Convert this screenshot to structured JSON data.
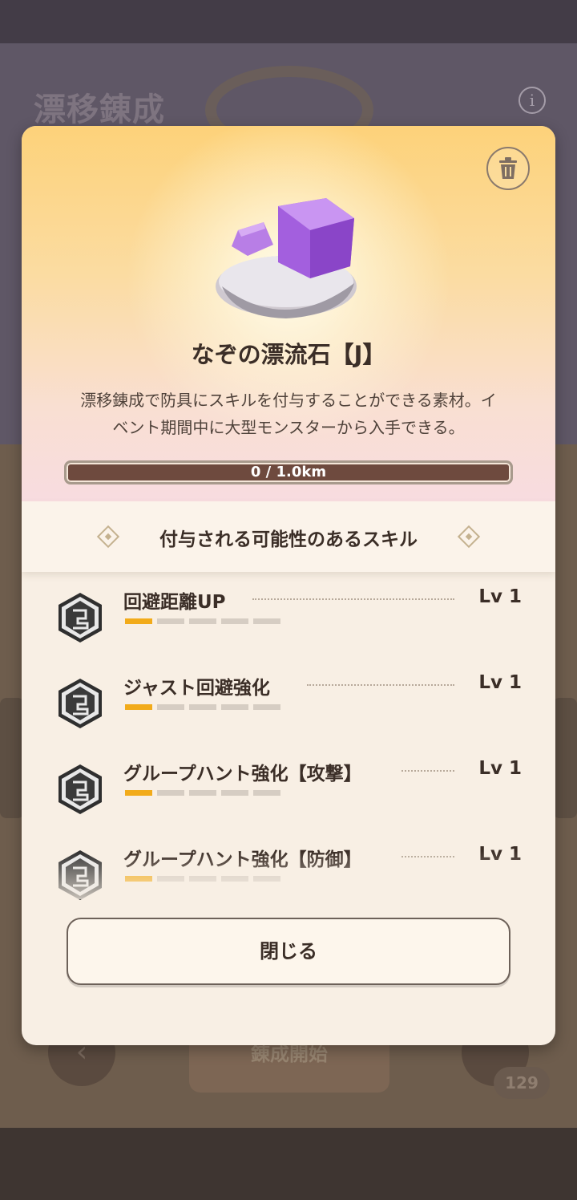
{
  "background": {
    "screen_title": "漂移錬成",
    "start_button_label": "錬成開始",
    "item_count": "129"
  },
  "modal": {
    "item_name": "なぞの漂流石【J】",
    "item_description_line1": "漂移錬成で防具にスキルを付与することができる素材。イ",
    "item_description_line2": "ベント期間中に大型モンスターから入手できる。",
    "progress": {
      "text": "0 / 1.0km",
      "fraction": 0.0
    },
    "skills_section_title": "付与される可能性のあるスキル",
    "skills": [
      {
        "name": "回避距離UP",
        "level_label": "Lv 1",
        "level": 1,
        "max_level": 5
      },
      {
        "name": "ジャスト回避強化",
        "level_label": "Lv 1",
        "level": 1,
        "max_level": 5
      },
      {
        "name": "グループハント強化【攻撃】",
        "level_label": "Lv 1",
        "level": 1,
        "max_level": 5
      },
      {
        "name": "グループハント強化【防御】",
        "level_label": "Lv 1",
        "level": 1,
        "max_level": 5
      }
    ],
    "close_button_label": "閉じる"
  },
  "icons": {
    "trash": "trash-icon",
    "info": "info-icon",
    "skill_badge": "skill-badge-icon",
    "diamond": "diamond-ornament-icon",
    "back": "chevron-left-icon"
  },
  "colors": {
    "accent_level": "#f2ab1a",
    "level_inactive": "#d6cdc3",
    "progress_track": "#6e4a3e",
    "text_dark": "#3b2e27"
  }
}
